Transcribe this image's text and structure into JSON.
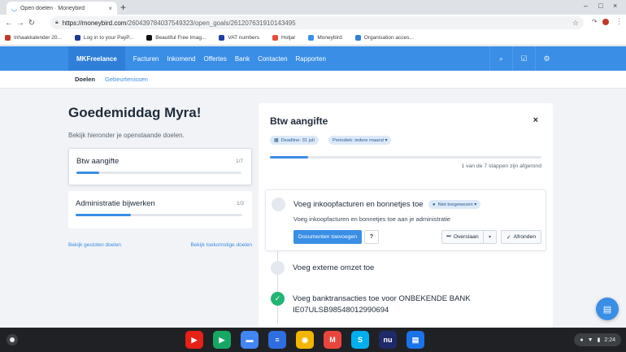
{
  "browser": {
    "tab_title": "Open doelen · Moneybird",
    "tab_close": "×",
    "new_tab": "+",
    "url_host": "https://moneybird.com",
    "url_path": "/260439784037549323/open_goals/261207631910143495",
    "back": "←",
    "forward": "→",
    "reload": "↻",
    "star": "☆",
    "window_min": "–",
    "window_max": "□",
    "window_close": "×"
  },
  "bookmarks": [
    {
      "label": "Inhaakkalender 20...",
      "icon": "calendar-icon",
      "color": "#c0392b"
    },
    {
      "label": "Log in to your PayP...",
      "icon": "paypal-icon",
      "color": "#1f3a93"
    },
    {
      "label": "Beautiful Free Imag...",
      "icon": "unsplash-icon",
      "color": "#111111"
    },
    {
      "label": "VAT numbers",
      "icon": "eu-flag-icon",
      "color": "#1f3fa6"
    },
    {
      "label": "Hotjar",
      "icon": "hotjar-icon",
      "color": "#e74c3c"
    },
    {
      "label": "Moneybird",
      "icon": "moneybird-icon",
      "color": "#3a8ee6"
    },
    {
      "label": "Organisation acces...",
      "icon": "organisation-icon",
      "color": "#2f7fd9"
    }
  ],
  "app": {
    "brand": "MKFreelance",
    "nav": [
      "Facturen",
      "Inkomend",
      "Offertes",
      "Bank",
      "Contacten",
      "Rapporten"
    ],
    "icons": {
      "search": "⌕",
      "tasks": "☑",
      "settings": "⚙"
    },
    "subnav_active": "Doelen",
    "subnav_link": "Gebeurtenissen"
  },
  "left": {
    "greeting": "Goedemiddag Myra!",
    "intro": "Bekijk hieronder je openstaande doelen.",
    "goals": [
      {
        "title": "Btw aangifte",
        "count": "1/7",
        "progress": 0.14
      },
      {
        "title": "Administratie bijwerken",
        "count": "1/3",
        "progress": 0.33
      }
    ],
    "link_closed": "Bekijk gesloten doelen",
    "link_future": "Bekijk toekomstige doelen"
  },
  "panel": {
    "title": "Btw aangifte",
    "close": "×",
    "deadline": "Deadline: 31 juli",
    "period": "Periodiek: iedere maand ▾",
    "progress": 0.14,
    "step_summary": "1 van de 7 stappen zijn afgerond",
    "step1": {
      "title": "Voeg inkoopfacturen en bonnetjes toe",
      "assignee": "Niet toegewezen ▾",
      "description": "Voeg inkoopfacturen en bonnetjes toe aan je administratie",
      "add_button": "Documenten toevoegen",
      "help_button": "?",
      "skip_button": "Overslaan",
      "skip_caret": "▾",
      "done_button": "Afronden"
    },
    "step2": {
      "title": "Voeg externe omzet toe"
    },
    "step3": {
      "title": "Voeg banktransacties toe voor ONBEKENDE BANK",
      "title_line2": "IE07ULSB98548012990694"
    }
  },
  "shelf": {
    "apps": [
      {
        "name": "youtube-icon",
        "glyph": "▶",
        "color": "#e62117"
      },
      {
        "name": "play-store-icon",
        "glyph": "▶",
        "color": "#16a765"
      },
      {
        "name": "files-icon",
        "glyph": "▬",
        "color": "#4285f4"
      },
      {
        "name": "docs-icon",
        "glyph": "≡",
        "color": "#2f6de1"
      },
      {
        "name": "chrome-icon",
        "glyph": "◉",
        "color": "#f2b600"
      },
      {
        "name": "gmail-icon",
        "glyph": "M",
        "color": "#e8453c"
      },
      {
        "name": "skype-icon",
        "glyph": "S",
        "color": "#00aff0"
      },
      {
        "name": "nu-icon",
        "glyph": "nu",
        "color": "#1f2a6b"
      },
      {
        "name": "messages-icon",
        "glyph": "▤",
        "color": "#1a73e8"
      }
    ],
    "time": "2:24"
  }
}
